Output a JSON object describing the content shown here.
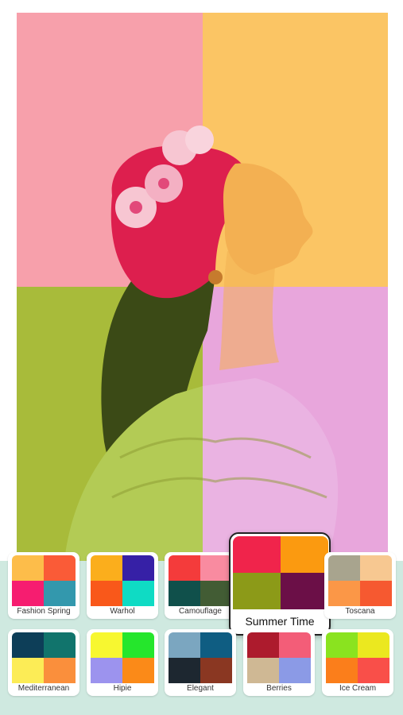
{
  "photo": {
    "quadrants": [
      "#f7a0ab",
      "#fbc564",
      "#a8bb3a",
      "#e8a6dc"
    ],
    "hair": "#dd1f4e",
    "hair_lower": "#3b4a16",
    "flower": "#f7c6d2",
    "skin": "#f3b052",
    "blouse_left": "#b3cb55",
    "blouse_right": "#eab3e2"
  },
  "palettes": [
    {
      "name": "Fashion Spring",
      "colors": [
        "#fdbd4a",
        "#fa5b37",
        "#f61d70",
        "#3398ad"
      ],
      "selected": false
    },
    {
      "name": "Warhol",
      "colors": [
        "#fbae1c",
        "#3620a6",
        "#f9581a",
        "#0fdbc4"
      ],
      "selected": false
    },
    {
      "name": "Camouflage",
      "colors": [
        "#f43b3b",
        "#f98ba0",
        "#10504b",
        "#425c34"
      ],
      "selected": false
    },
    {
      "name": "Summer Time",
      "colors": [
        "#f0244b",
        "#fb9a10",
        "#8c9a18",
        "#6b0f47"
      ],
      "selected": true
    },
    {
      "name": "Toscana",
      "colors": [
        "#a8a48e",
        "#f7c891",
        "#fb9747",
        "#f65930"
      ],
      "selected": false
    },
    {
      "name": "Mediterranean",
      "colors": [
        "#0d3e58",
        "#11746c",
        "#fcec56",
        "#fa8f3c"
      ],
      "selected": false
    },
    {
      "name": "Hipie",
      "colors": [
        "#f7f730",
        "#25e62c",
        "#9c93ee",
        "#fb8a18"
      ],
      "selected": false
    },
    {
      "name": "Elegant",
      "colors": [
        "#7ba6c0",
        "#0f5d82",
        "#1d2730",
        "#8a3722"
      ],
      "selected": false
    },
    {
      "name": "Berries",
      "colors": [
        "#ad1b2d",
        "#f35d78",
        "#cfb894",
        "#8b9ae6"
      ],
      "selected": false
    },
    {
      "name": "Ice Cream",
      "colors": [
        "#8ae31f",
        "#ebe81f",
        "#fb7e1b",
        "#f94f49"
      ],
      "selected": false
    }
  ]
}
